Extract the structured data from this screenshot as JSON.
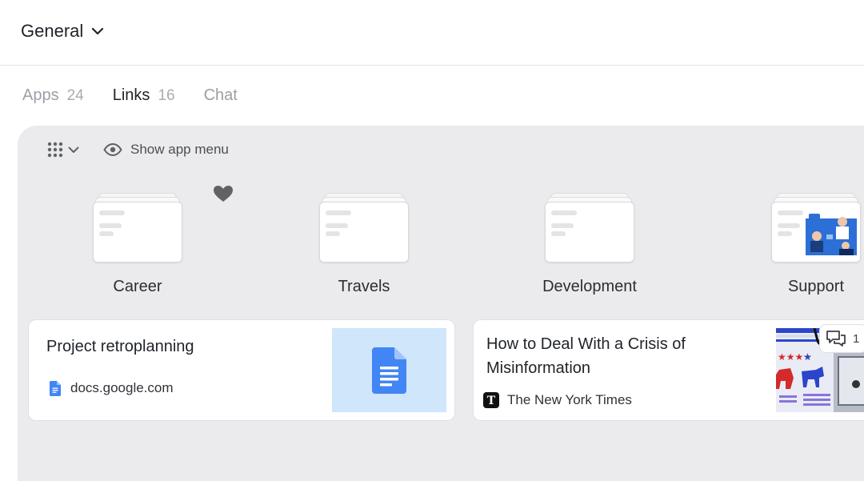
{
  "header": {
    "title": "General"
  },
  "tabs": [
    {
      "label": "Apps",
      "count": "24"
    },
    {
      "label": "Links",
      "count": "16"
    },
    {
      "label": "Chat",
      "count": ""
    }
  ],
  "toolbar": {
    "show_menu_label": "Show app menu"
  },
  "folders": [
    {
      "label": "Career"
    },
    {
      "label": "Travels"
    },
    {
      "label": "Development"
    },
    {
      "label": "Support"
    }
  ],
  "cards": [
    {
      "title": "Project retroplanning",
      "source": "docs.google.com"
    },
    {
      "title_line1": "How to Deal With a Crisis of",
      "title_line2": "Misinformation",
      "source": "The New York Times"
    }
  ],
  "comments": {
    "count": "1"
  },
  "colors": {
    "accent": "#1f2329",
    "docs_blue": "#4285f4",
    "panel_bg": "#ebebed",
    "thumb_bg": "#cfe6fb"
  }
}
